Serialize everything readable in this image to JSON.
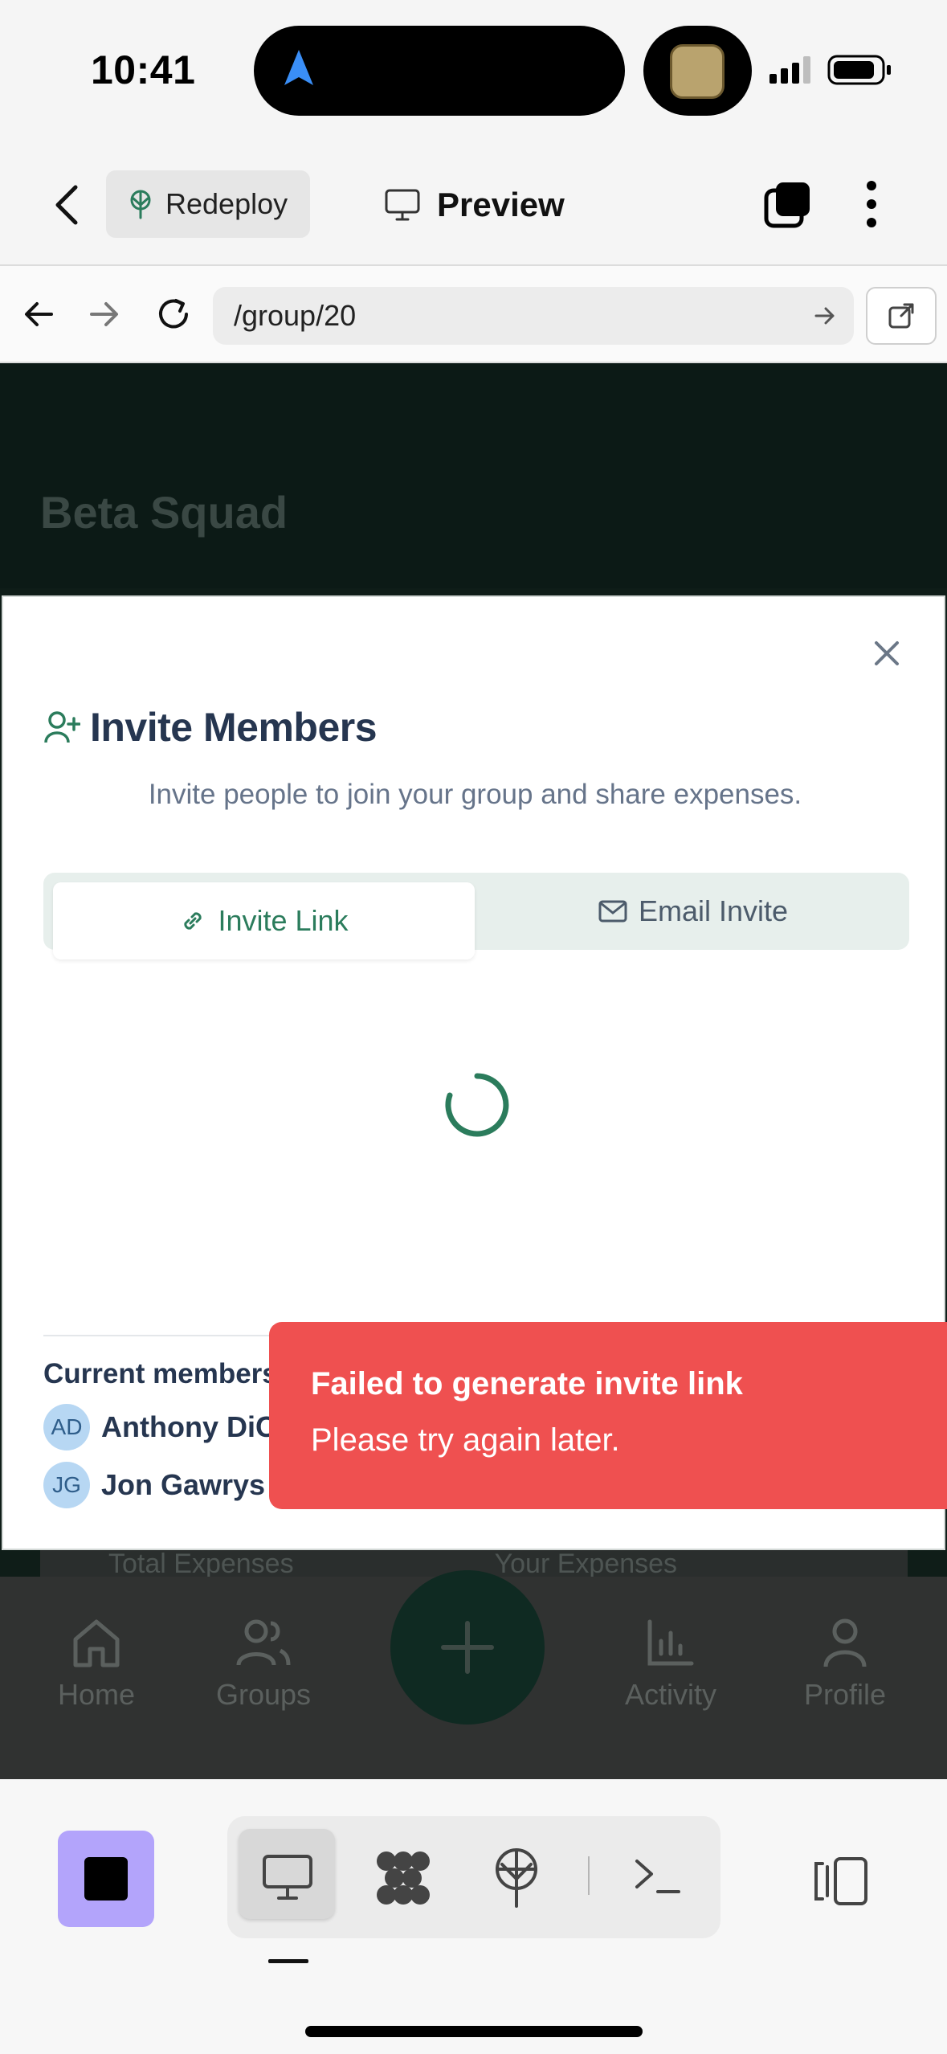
{
  "status_bar": {
    "time": "10:41"
  },
  "app_header": {
    "redeploy_label": "Redeploy",
    "preview_label": "Preview"
  },
  "browser": {
    "url": "/group/20"
  },
  "web_page": {
    "group_title": "Beta Squad",
    "stats": [
      "Total Expenses",
      "Your Expenses"
    ],
    "nav": {
      "home": "Home",
      "groups": "Groups",
      "activity": "Activity",
      "profile": "Profile"
    }
  },
  "modal": {
    "title": "Invite Members",
    "description": "Invite people to join your group and share expenses.",
    "tabs": [
      {
        "label": "Invite Link",
        "active": true
      },
      {
        "label": "Email Invite",
        "active": false
      }
    ],
    "members_title": "Current members",
    "members": [
      {
        "initials": "AD",
        "name": "Anthony DiCenzo"
      },
      {
        "initials": "JG",
        "name": "Jon Gawrys"
      }
    ]
  },
  "toast": {
    "title": "Failed to generate invite link",
    "message": "Please try again later.",
    "color": "#ef5050"
  },
  "colors": {
    "accent_green": "#2b7c5c",
    "heading": "#263650",
    "stop_button": "#b3a4fb"
  }
}
